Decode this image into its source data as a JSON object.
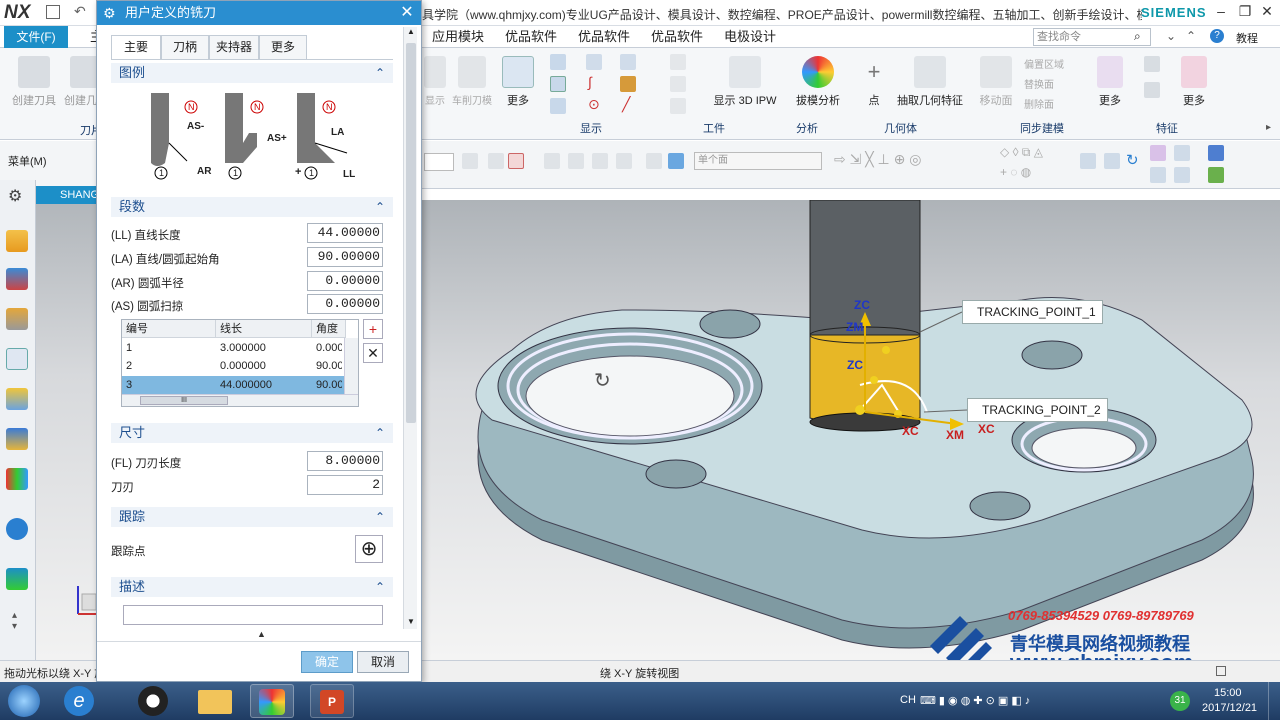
{
  "titlebar": {
    "app_logo": "NX",
    "title": "具学院（www.qhmjxy.com)专业UG产品设计、模具设计、数控编程、PROE产品设计、powermill数控编程、五轴加工、创新手绘设计、模流...",
    "brand": "SIEMENS",
    "window_controls": [
      "minimize-icon",
      "restore-icon",
      "close-icon"
    ]
  },
  "menu": {
    "file": "文件(F)",
    "tab_partial": "主",
    "tabs": [
      "应用模块",
      "优品软件",
      "优品软件",
      "优品软件",
      "电极设计"
    ],
    "search_placeholder": "查找命令",
    "help": "教程"
  },
  "ribbon": {
    "left_buttons": [
      "创建刀具",
      "创建几何"
    ],
    "left_group": "刀片",
    "menu_btn": "菜单(M)",
    "buttons": [
      "更多",
      "显示 3D IPW",
      "拔模分析",
      "点",
      "抽取几何特征",
      "更多",
      "更多"
    ],
    "ghost_buttons": [
      "显示",
      "车削刀模",
      "移动面",
      "偏置区域",
      "替换面",
      "删除面"
    ],
    "groups": [
      "显示",
      "工件",
      "分析",
      "几何体",
      "同步建模",
      "特征"
    ],
    "dropdown_value": "单个面"
  },
  "dialog": {
    "title": "用户定义的铣刀",
    "tabs": [
      "主要",
      "刀柄",
      "夹持器",
      "更多"
    ],
    "sections": {
      "legend": "图例",
      "segments": "段数",
      "size": "尺寸",
      "tracking": "跟踪",
      "description": "描述"
    },
    "legend_labels": [
      "N",
      "AS-",
      "AR",
      "1",
      "N",
      "AS+",
      "1",
      "N",
      "LA",
      "LL",
      "1",
      "+"
    ],
    "fields": [
      {
        "label": "(LL) 直线长度",
        "value": "44.00000"
      },
      {
        "label": "(LA) 直线/圆弧起始角",
        "value": "90.00000"
      },
      {
        "label": "(AR) 圆弧半径",
        "value": "0.00000"
      },
      {
        "label": "(AS) 圆弧扫掠",
        "value": "0.00000"
      }
    ],
    "table": {
      "headers": [
        "编号",
        "线长",
        "角度"
      ],
      "rows": [
        [
          "1",
          "3.000000",
          "0.000"
        ],
        [
          "2",
          "0.000000",
          "90.00"
        ],
        [
          "3",
          "44.000000",
          "90.00"
        ]
      ],
      "scroll_label": "III"
    },
    "size_fields": [
      {
        "label": "(FL) 刀刃长度",
        "value": "8.00000"
      },
      {
        "label": "刀刃",
        "value": "2"
      }
    ],
    "tracking_label": "跟踪点",
    "ok": "确定",
    "cancel": "取消"
  },
  "viewport": {
    "tab": "SHANG",
    "tracking_points": [
      "TRACKING_POINT_1",
      "TRACKING_POINT_2"
    ],
    "axis_labels": [
      "ZC",
      "ZM",
      "ZC",
      "XC",
      "XM",
      "XC"
    ],
    "watermark_phone": "0769-85394529  0769-89789769",
    "watermark_cn": "青华模具网络视频教程",
    "watermark_url": "www.qhmjxy.com"
  },
  "status": {
    "left": "拖动光标以绕 X-Y 旋",
    "center": "绕 X-Y 旋转视图"
  },
  "taskbar": {
    "time": "15:00",
    "date": "2017/12/21",
    "lang": "CH",
    "badge": "31"
  },
  "colors": {
    "accent": "#1c8fc8",
    "dialog_title": "#2a8ed0",
    "part": "#a8c4cc",
    "tool": "#5b6064",
    "holder": "#e7b726",
    "table_selected": "#7fb8e0",
    "watermark_red": "#e03030",
    "watermark_blue": "#1a4fa0"
  }
}
